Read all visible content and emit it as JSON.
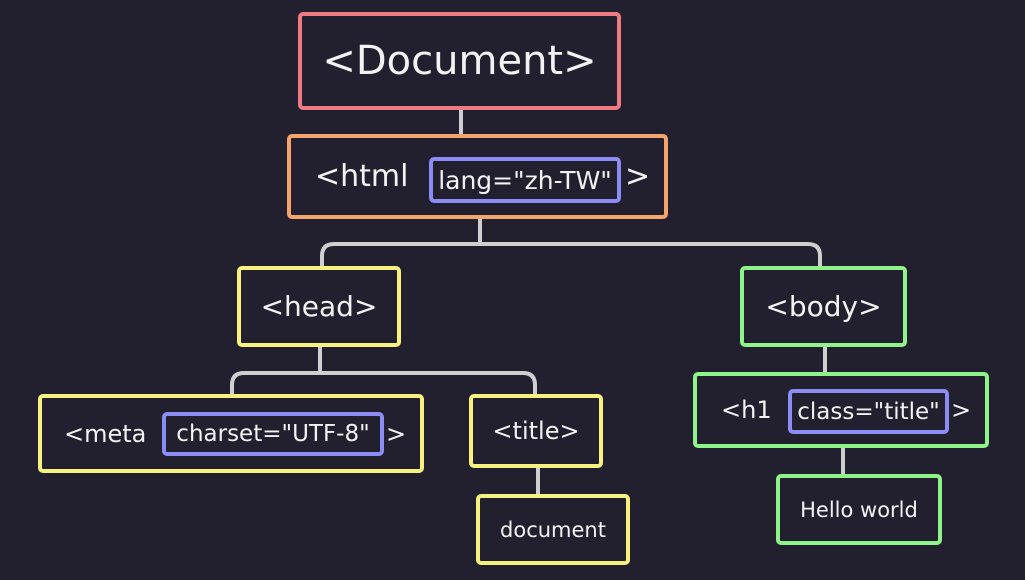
{
  "colors": {
    "background": "#22202e",
    "text": "#f2f2f2",
    "connector": "#cfcfcf",
    "document_border": "#f07a82",
    "html_border": "#f5a56c",
    "head_border": "#f7f17f",
    "body_border": "#8ef48a",
    "attribute_border": "#8b8cf4"
  },
  "nodes": {
    "document": {
      "label": "<Document>"
    },
    "html": {
      "label": "<html",
      "attribute": "lang=\"zh-TW\"",
      "close": ">"
    },
    "head": {
      "label": "<head>"
    },
    "body": {
      "label": "<body>"
    },
    "meta": {
      "label": "<meta",
      "attribute": "charset=\"UTF-8\"",
      "close": ">"
    },
    "title": {
      "label": "<title>"
    },
    "title_text": {
      "label": "document"
    },
    "h1": {
      "label": "<h1",
      "attribute": "class=\"title\"",
      "close": ">"
    },
    "h1_text": {
      "label": "Hello world"
    }
  }
}
